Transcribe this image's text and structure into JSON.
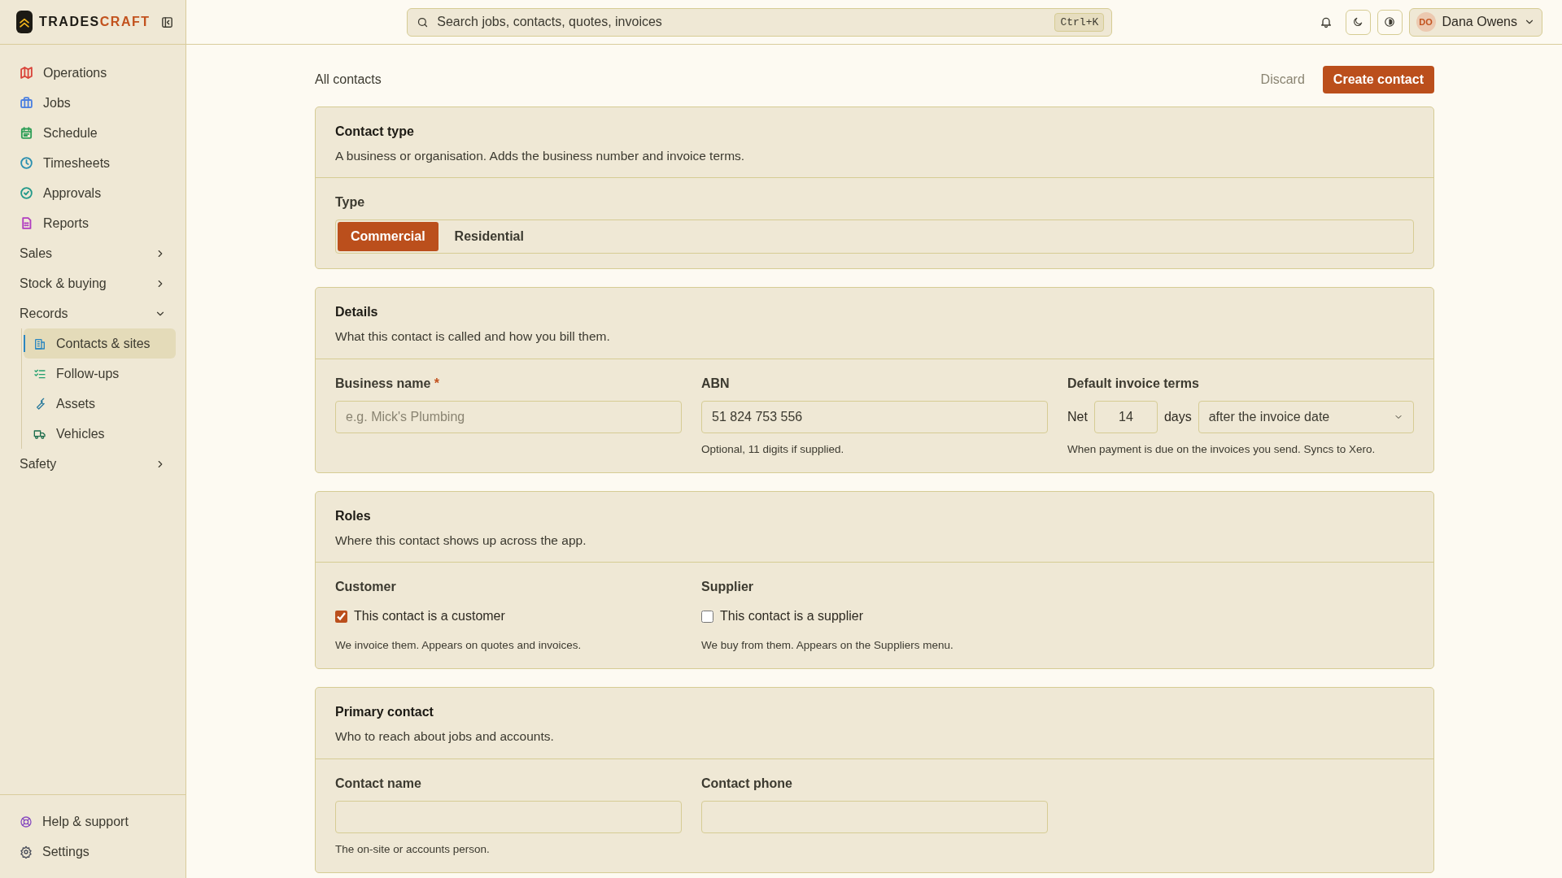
{
  "brand": {
    "first": "TRADES",
    "second": "CRAFT"
  },
  "sidebar": {
    "items": [
      {
        "kind": "link",
        "label": "Operations",
        "color": "#d9443a",
        "selected": false
      },
      {
        "kind": "link",
        "label": "Jobs",
        "color": "#4a7fe0",
        "selected": false
      },
      {
        "kind": "link",
        "label": "Schedule",
        "color": "#2e9e57",
        "selected": false
      },
      {
        "kind": "link",
        "label": "Timesheets",
        "color": "#2a8fb0",
        "selected": false
      },
      {
        "kind": "link",
        "label": "Approvals",
        "color": "#23998a",
        "selected": false
      },
      {
        "kind": "link",
        "label": "Reports",
        "color": "#b03cc0",
        "selected": false
      },
      {
        "kind": "group",
        "label": "Sales",
        "expanded": false
      },
      {
        "kind": "group",
        "label": "Stock & buying",
        "expanded": false
      },
      {
        "kind": "group",
        "label": "Records",
        "expanded": true,
        "children": [
          {
            "label": "Contacts & sites",
            "color": "#2a86c0",
            "selected": true
          },
          {
            "label": "Follow-ups",
            "color": "#23a06e",
            "selected": false
          },
          {
            "label": "Assets",
            "color": "#2a7a9c",
            "selected": false
          },
          {
            "label": "Vehicles",
            "color": "#1f6e4e",
            "selected": false
          }
        ]
      },
      {
        "kind": "group",
        "label": "Safety",
        "expanded": false
      }
    ],
    "footer": [
      {
        "label": "Help & support",
        "color": "#8a4fc0"
      },
      {
        "label": "Settings",
        "color": "#4a4e5a"
      }
    ]
  },
  "search": {
    "placeholder": "Search jobs, contacts, quotes, invoices",
    "shortcut": "Ctrl+K"
  },
  "user": {
    "initials": "DO",
    "name": "Dana Owens"
  },
  "breadcrumb": "All contacts",
  "actions": {
    "discard": "Discard",
    "create": "Create contact"
  },
  "contact_type": {
    "title": "Contact type",
    "description": "A business or organisation. Adds the business number and invoice terms.",
    "label": "Type",
    "options": [
      {
        "label": "Commercial",
        "selected": true
      },
      {
        "label": "Residential",
        "selected": false
      }
    ]
  },
  "details": {
    "title": "Details",
    "description": "What this contact is called and how you bill them.",
    "business_name": {
      "label": "Business name",
      "required_mark": "*",
      "placeholder": "e.g. Mick's Plumbing"
    },
    "abn": {
      "label": "ABN",
      "value": "51 824 753 556",
      "hint": "Optional, 11 digits if supplied."
    },
    "terms": {
      "label": "Default invoice terms",
      "prefix": "Net",
      "days": "14",
      "unit": "days",
      "basis": "after the invoice date",
      "hint": "When payment is due on the invoices you send. Syncs to Xero."
    }
  },
  "roles": {
    "title": "Roles",
    "description": "Where this contact shows up across the app.",
    "items": [
      {
        "label": "Customer",
        "checkbox": "This contact is a customer",
        "checked": true,
        "hint": "We invoice them. Appears on quotes and invoices."
      },
      {
        "label": "Supplier",
        "checkbox": "This contact is a supplier",
        "checked": false,
        "hint": "We buy from them. Appears on the Suppliers menu."
      }
    ]
  },
  "primary_contact": {
    "title": "Primary contact",
    "description": "Who to reach about jobs and accounts.",
    "fields": [
      {
        "label": "Contact name",
        "hint": "The on-site or accounts person."
      },
      {
        "label": "Contact phone"
      }
    ]
  }
}
